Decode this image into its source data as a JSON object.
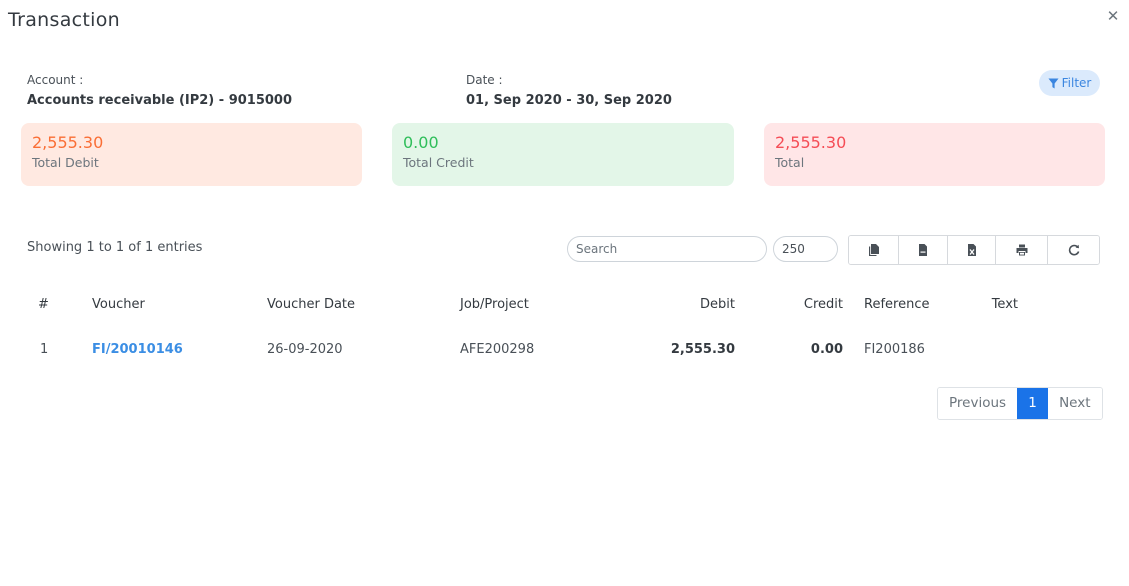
{
  "modal": {
    "title": "Transaction",
    "close_icon": "close-icon"
  },
  "info": {
    "account_label": "Account :",
    "account_value": "Accounts receivable (IP2) - 9015000",
    "date_label": "Date :",
    "date_value": "01, Sep 2020 - 30, Sep 2020"
  },
  "filter": {
    "label": "Filter",
    "icon": "filter-icon",
    "color": "#3b86e0"
  },
  "summary": {
    "debit": {
      "value": "2,555.30",
      "label": "Total Debit",
      "color": "#fa6e35"
    },
    "credit": {
      "value": "0.00",
      "label": "Total Credit",
      "color": "#2fbe5a"
    },
    "total": {
      "value": "2,555.30",
      "label": "Total",
      "color": "#f54c55"
    }
  },
  "table_controls": {
    "showing_text": "Showing 1 to 1 of 1 entries",
    "search_placeholder": "Search",
    "page_length": "250",
    "buttons": [
      {
        "name": "copy",
        "icon": "copy-icon"
      },
      {
        "name": "csv",
        "icon": "csv-file-icon"
      },
      {
        "name": "excel",
        "icon": "excel-file-icon"
      },
      {
        "name": "print",
        "icon": "print-icon"
      },
      {
        "name": "refresh",
        "icon": "refresh-icon"
      }
    ]
  },
  "table": {
    "columns": [
      "#",
      "Voucher",
      "Voucher Date",
      "Job/Project",
      "Debit",
      "Credit",
      "Reference",
      "Text"
    ],
    "rows": [
      {
        "num": "1",
        "voucher": "FI/20010146",
        "voucher_date": "26-09-2020",
        "job_project": "AFE200298",
        "debit": "2,555.30",
        "credit": "0.00",
        "reference": "FI200186",
        "text": ""
      }
    ]
  },
  "pagination": {
    "previous": "Previous",
    "current": "1",
    "next": "Next",
    "active_color": "#1a73e8"
  }
}
